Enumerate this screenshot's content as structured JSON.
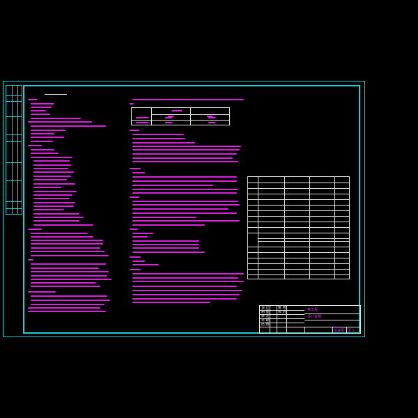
{
  "drawing": {
    "frame_color": "#19d4d4",
    "text_color": "#e020e0",
    "table_color": "#e6e6e6",
    "background": "#000000"
  },
  "title_block": {
    "rows": [
      {
        "label": "设 计",
        "value": "审 核"
      },
      {
        "label": "制 图",
        "value": "校 对"
      },
      {
        "label": "审 定",
        "value": ""
      },
      {
        "label": "日 期",
        "value": ""
      },
      {
        "label": "比 例",
        "value": ""
      }
    ],
    "project_name": "某工程",
    "drawing_name": "设计说明",
    "drawing_no": "总说明",
    "sheet": "页 1"
  }
}
